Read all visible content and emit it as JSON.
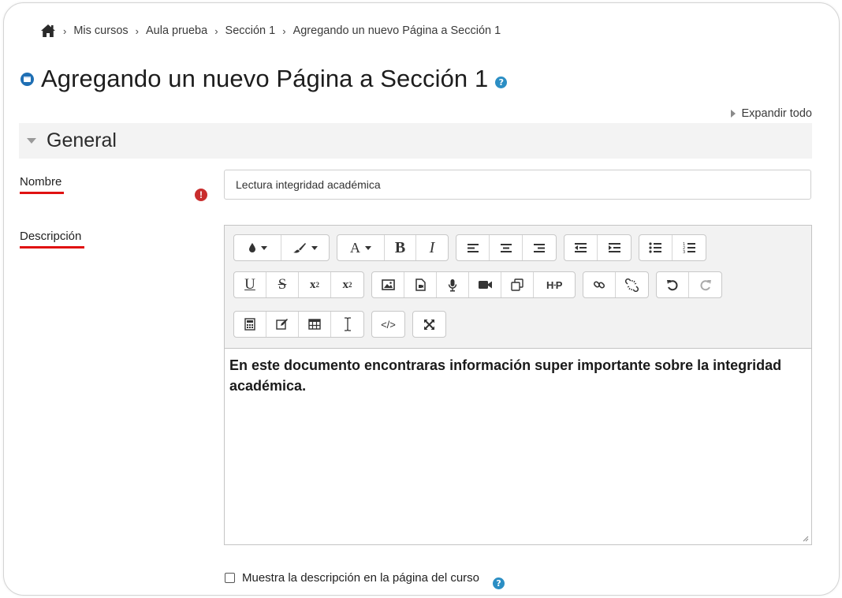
{
  "breadcrumb": {
    "items": [
      "Mis cursos",
      "Aula prueba",
      "Sección 1",
      "Agregando un nuevo Página a Sección 1"
    ]
  },
  "page": {
    "title": "Agregando un nuevo Página a Sección 1",
    "expand_all": "Expandir todo"
  },
  "section": {
    "label": "General"
  },
  "form": {
    "name_label": "Nombre",
    "name_value": "Lectura integridad académica",
    "description_label": "Descripción",
    "description_text": "En este documento encontraras información super importante sobre la integridad académica.",
    "show_description_label": "Muestra la descripción en la página del curso"
  },
  "icons": {
    "home": "home-icon",
    "required": "exclamation-circle-icon",
    "help": "question-circle-icon",
    "module": "page-module-icon"
  },
  "colors": {
    "accent": "#2b8ec4",
    "required": "#c92d2d",
    "underline": "#e01212",
    "module": "#1f6fb4"
  }
}
